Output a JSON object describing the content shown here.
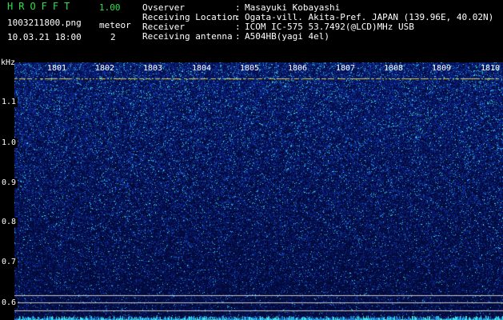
{
  "header": {
    "app_name": "HROFFT",
    "version": "1.00",
    "file_name": "1003211800.png",
    "mode_label": "meteor",
    "date_time": "10.03.21 18:00",
    "mode_count": "2"
  },
  "station_info": [
    {
      "key": "Ovserver",
      "sep": ":",
      "value": "Masayuki Kobayashi"
    },
    {
      "key": "Receiving Location",
      "sep": ":",
      "value": "Ogata-vill. Akita-Pref. JAPAN (139.96E, 40.02N)"
    },
    {
      "key": "Receiver",
      "sep": ":",
      "value": "ICOM IC-575 53.7492(@LCD)MHz USB"
    },
    {
      "key": "Receiving antenna",
      "sep": ":",
      "value": "A504HB(yagi 4el)"
    }
  ],
  "spectrogram": {
    "y_unit": "kHz",
    "y_ticks": [
      "1.1",
      "1.0",
      "0.9",
      "0.8",
      "0.7",
      "0.6"
    ],
    "x_ticks": [
      "1801",
      "1802",
      "1803",
      "1804",
      "1805",
      "1806",
      "1807",
      "1808",
      "1809",
      "1810"
    ],
    "colors": {
      "background": "#020a3a",
      "noise_low": "#1030b0",
      "noise_high": "#30e0e0",
      "reference_line": "#c8c8c8",
      "carrier_line": "#e0d040"
    }
  }
}
